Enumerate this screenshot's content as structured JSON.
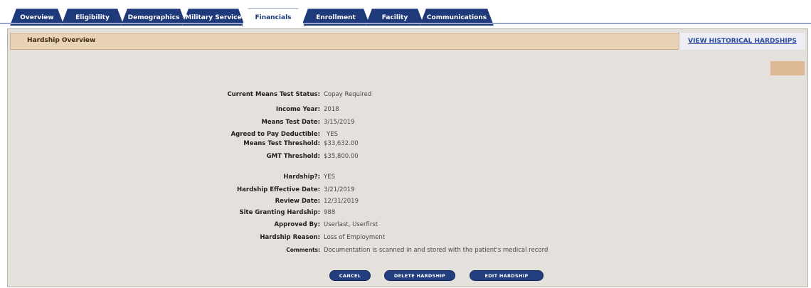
{
  "tabs": [
    "Overview",
    "Eligibility",
    "Demographics",
    "Military Service",
    "Financials",
    "Enrollment",
    "Facility",
    "Communications"
  ],
  "active_tab": "Financials",
  "header": {
    "title": "Hardship Overview",
    "history_link": "VIEW HISTORICAL HARDSHIPS"
  },
  "fields": {
    "means_status": {
      "label": "Current Means Test Status:",
      "value": "Copay Required"
    },
    "income_year": {
      "label": "Income Year:",
      "value": "2018"
    },
    "means_date": {
      "label": "Means Test Date:",
      "value": "3/15/2019"
    },
    "agreed_deductible": {
      "label": "Agreed to Pay Deductible:",
      "value": "YES"
    },
    "means_threshold": {
      "label": "Means Test Threshold:",
      "value": "$33,632.00"
    },
    "gmt_threshold": {
      "label": "GMT Threshold:",
      "value": "$35,800.00"
    },
    "hardship": {
      "label": "Hardship?:",
      "value": "YES"
    },
    "effective_date": {
      "label": "Hardship Effective Date:",
      "value": "3/21/2019"
    },
    "review_date": {
      "label": "Review Date:",
      "value": "12/31/2019"
    },
    "site": {
      "label": "Site Granting Hardship:",
      "value": "988"
    },
    "approved_by": {
      "label": "Approved By:",
      "value": "Userlast, Userfirst"
    },
    "reason": {
      "label": "Hardship Reason:",
      "value": "Loss of Employment"
    },
    "comments": {
      "label": "Comments:",
      "value": "Documentation is scanned in and stored with the patient's medical record"
    }
  },
  "buttons": {
    "cancel": "CANCEL",
    "delete": "DELETE HARDSHIP",
    "edit": "EDIT HARDSHIP"
  }
}
